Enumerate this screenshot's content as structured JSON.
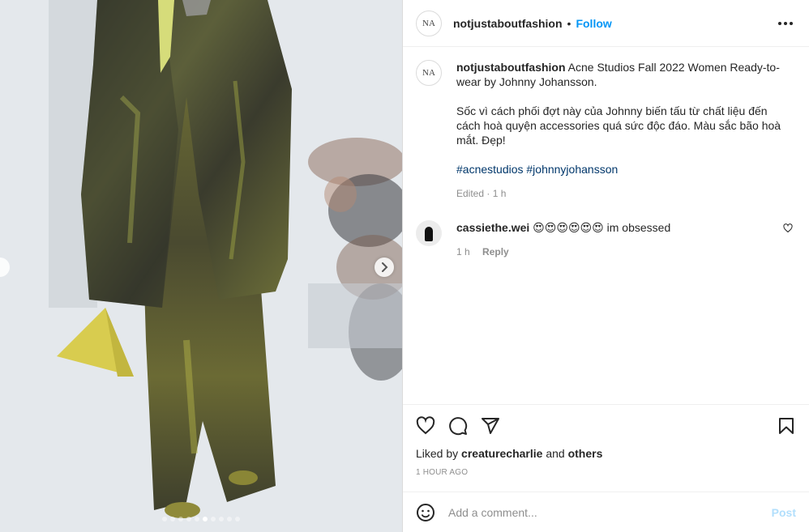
{
  "post": {
    "username": "notjustaboutfashion",
    "separator": "•",
    "follow_label": "Follow",
    "avatar_monogram": "NA"
  },
  "caption": {
    "username": "notjustaboutfashion",
    "text_line1": "Acne Studios Fall 2022 Women Ready-to-wear by Johnny Johansson.",
    "text_line2": "Sốc vì cách phối đợt này của Johnny biến tấu từ chất liệu đến cách hoà quyện accessories quá sức độc đáo. Màu sắc bão hoà mắt. Đẹp!",
    "hashtags": "#acnestudios #johnnyjohansson",
    "meta": "Edited · 1 h"
  },
  "comment": {
    "username": "cassiethe.wei",
    "emojis": "😍😍😍😍😍😍",
    "text": "im obsessed",
    "time": "1 h",
    "reply_label": "Reply"
  },
  "likes": {
    "prefix": "Liked by",
    "user": "creaturecharlie",
    "and": "and",
    "others": "others"
  },
  "timestamp": "1 HOUR AGO",
  "add_comment": {
    "placeholder": "Add a comment...",
    "post_label": "Post"
  },
  "carousel": {
    "total": 10,
    "active_index": 5
  },
  "icons": [
    "heart-icon",
    "comment-icon",
    "share-icon",
    "bookmark-icon",
    "smile-icon",
    "more-icon",
    "chevron-right-icon"
  ],
  "colors": {
    "accent": "#0095f6",
    "link": "#00376b",
    "muted": "#8e8e8e",
    "post_disabled": "#b2dffc"
  }
}
